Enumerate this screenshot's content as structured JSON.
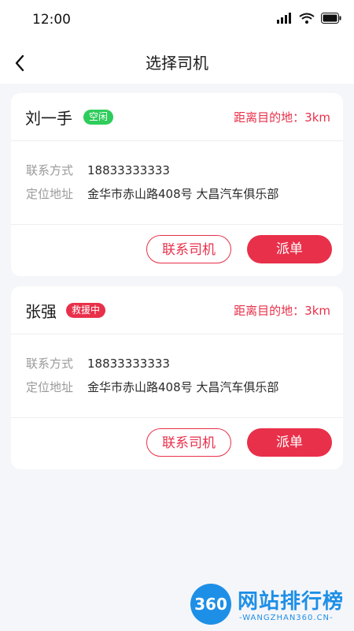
{
  "status": {
    "time": "12:00"
  },
  "nav": {
    "title": "选择司机"
  },
  "labels": {
    "contact": "联系方式",
    "address": "定位地址",
    "contact_button": "联系司机",
    "dispatch_button": "派单"
  },
  "drivers": [
    {
      "name": "刘一手",
      "status": "空闲",
      "distance": "距离目的地：3km",
      "phone": "18833333333",
      "address": "金华市赤山路408号  大昌汽车俱乐部"
    },
    {
      "name": "张强",
      "status": "救援中",
      "distance": "距离目的地：3km",
      "phone": "18833333333",
      "address": "金华市赤山路408号  大昌汽车俱乐部"
    }
  ],
  "watermark": {
    "logo": "360",
    "title": "网站排行榜",
    "sub": "-WANGZHAN360.CN-"
  },
  "colors": {
    "accent": "#e8304a",
    "idle": "#2ecc5b",
    "background": "#f5f6fa"
  },
  "icons": [
    "signal-icon",
    "wifi-icon",
    "battery-icon",
    "back-arrow-icon"
  ]
}
